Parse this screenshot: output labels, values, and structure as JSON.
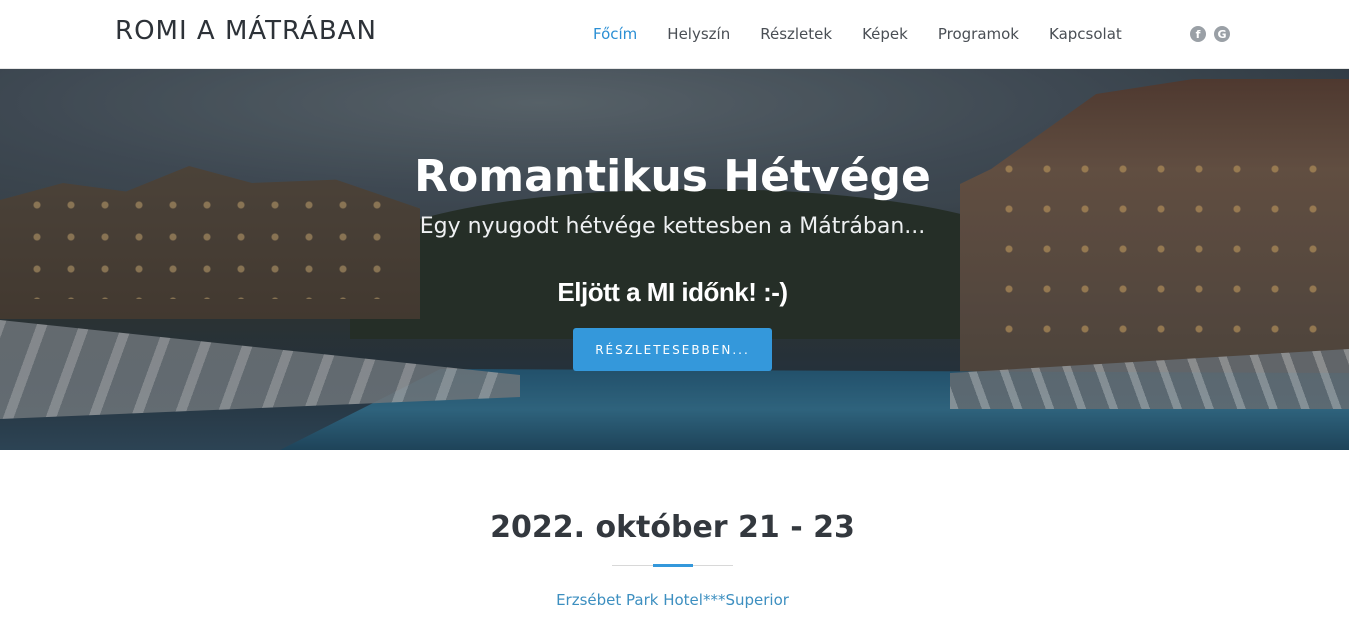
{
  "header": {
    "brand": "ROMI A MÁTRÁBAN",
    "nav": [
      "Főcím",
      "Helyszín",
      "Részletek",
      "Képek",
      "Programok",
      "Kapcsolat"
    ],
    "active_nav": "Főcím",
    "social": {
      "facebook": "f",
      "google": "G"
    }
  },
  "hero": {
    "title": "Romantikus Hétvége",
    "subtitle": "Egy nyugodt hétvége kettesben a Mátrában...",
    "tagline": "Eljött a MI időnk! :-)",
    "button_label": "RÉSZLETESEBBEN..."
  },
  "content": {
    "date": "2022. október 21 - 23",
    "venue": "Erzsébet Park Hotel***Superior"
  },
  "colors": {
    "accent": "#3498db",
    "nav_active": "#2b8fd4",
    "link": "#3d8fc0"
  },
  "icons": {
    "facebook": "facebook-icon",
    "google": "google-icon"
  }
}
